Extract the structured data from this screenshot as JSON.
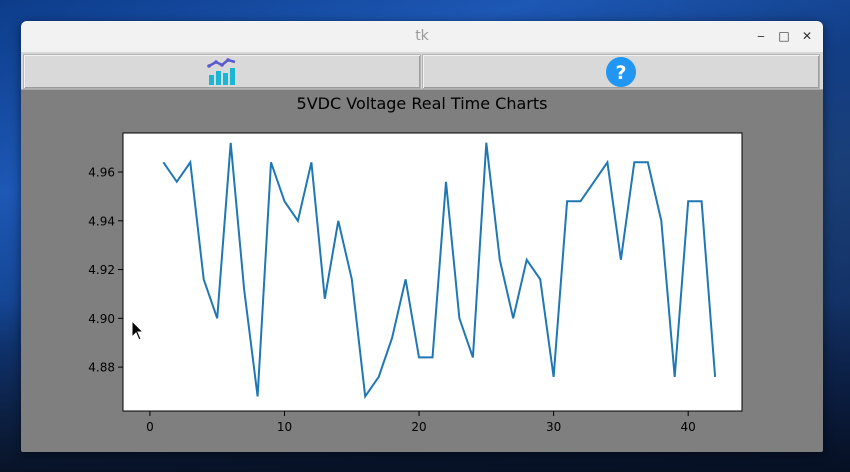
{
  "window": {
    "title": "tk"
  },
  "titlebar": {
    "minimize": "‒",
    "maximize": "□",
    "close": "✕"
  },
  "toolbar": {
    "chart_button_icon": "line-and-bar-chart-icon",
    "help_button_icon": "question-mark-icon",
    "help_glyph": "?",
    "colors": {
      "help_circle": "#2196f3",
      "bars": "#1ab6d6",
      "line": "#5a5ad0"
    }
  },
  "chart_data": {
    "type": "line",
    "title": "5VDC Voltage Real Time Charts",
    "xlabel": "",
    "ylabel": "",
    "xlim": [
      -2,
      44
    ],
    "ylim": [
      4.862,
      4.976
    ],
    "x_ticks": [
      0,
      10,
      20,
      30,
      40
    ],
    "y_ticks": [
      4.88,
      4.9,
      4.92,
      4.94,
      4.96
    ],
    "y_tick_labels": [
      "4.88",
      "4.90",
      "4.92",
      "4.94",
      "4.96"
    ],
    "grid": false,
    "line_color": "#1f77b4",
    "series": [
      {
        "x": [
          1,
          2,
          3,
          4,
          5,
          6,
          7,
          8,
          9,
          10,
          11,
          12,
          13,
          14,
          15,
          16,
          17,
          18,
          19,
          20,
          21,
          22,
          23,
          24,
          25,
          26,
          27,
          28,
          29,
          30,
          31,
          32,
          33,
          34,
          35,
          36,
          37,
          38,
          39,
          40,
          41,
          42
        ],
        "values": [
          4.964,
          4.956,
          4.964,
          4.916,
          4.9,
          4.972,
          4.912,
          4.868,
          4.964,
          4.948,
          4.94,
          4.964,
          4.908,
          4.94,
          4.916,
          4.868,
          4.876,
          4.892,
          4.916,
          4.884,
          4.884,
          4.956,
          4.9,
          4.884,
          4.972,
          4.924,
          4.9,
          4.924,
          4.916,
          4.876,
          4.948,
          4.948,
          4.956,
          4.964,
          4.924,
          4.964,
          4.964,
          4.94,
          4.876,
          4.948,
          4.948,
          4.876
        ]
      }
    ]
  }
}
